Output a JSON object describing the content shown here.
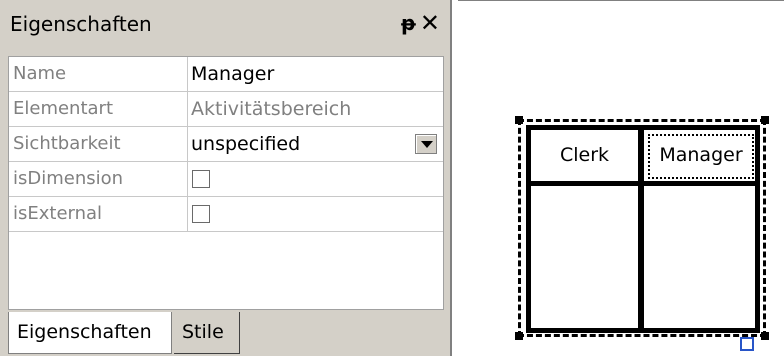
{
  "panel": {
    "title": "Eigenschaften",
    "pin_icon": "📌",
    "pin_glyph": "ᵽ",
    "close_glyph": "✕"
  },
  "properties": [
    {
      "label": "Name",
      "value": "Manager"
    },
    {
      "label": "Elementart",
      "value": "Aktivitätsbereich"
    },
    {
      "label": "Sichtbarkeit",
      "value": "unspecified"
    },
    {
      "label": "isDimension",
      "value": ""
    },
    {
      "label": "isExternal",
      "value": ""
    }
  ],
  "tabs": [
    {
      "label": "Eigenschaften"
    },
    {
      "label": "Stile"
    }
  ],
  "diagram": {
    "lanes": [
      {
        "label": "Clerk"
      },
      {
        "label": "Manager"
      }
    ]
  },
  "colors": {
    "panel_bg": "#d4d0c8",
    "handle_blue": "#2855c8"
  }
}
